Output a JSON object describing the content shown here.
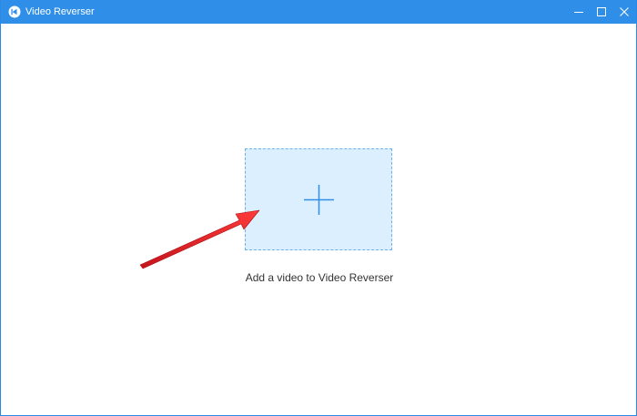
{
  "window": {
    "title": "Video Reverser",
    "titlebar_color": "#2f8fe8",
    "buttons": {
      "minimize_icon": "minimize-icon",
      "maximize_icon": "maximize-icon",
      "close_icon": "close-icon"
    }
  },
  "main": {
    "drop_zone": {
      "icon": "plus-icon",
      "fill_color": "#dcefff",
      "border_color": "#6fb0ea"
    },
    "drop_label": "Add a video to Video Reverser"
  },
  "annotation": {
    "arrow_color": "#e8262a"
  }
}
